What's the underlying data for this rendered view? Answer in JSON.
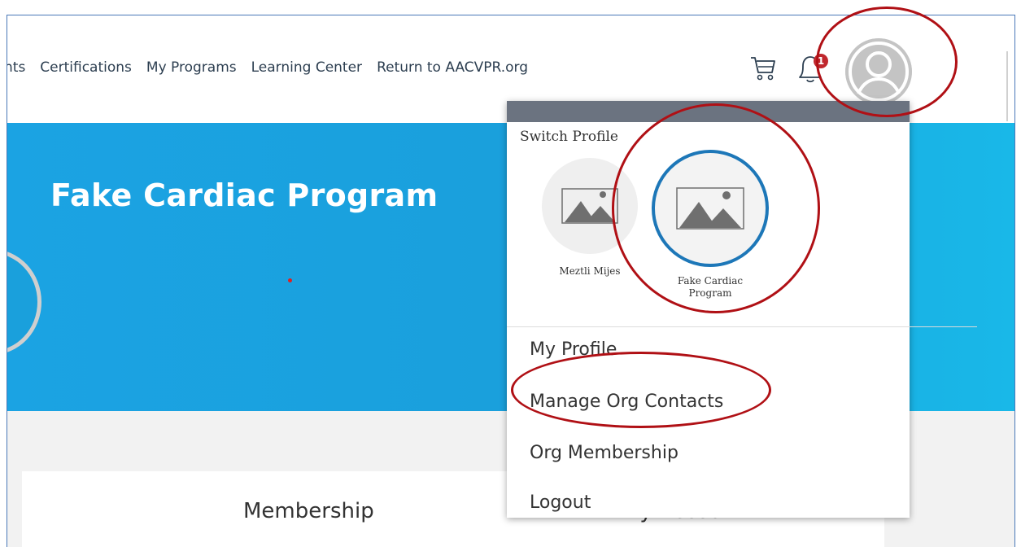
{
  "nav": {
    "links": [
      "nts",
      "Certifications",
      "My Programs",
      "Learning Center",
      "Return to AACVPR.org"
    ],
    "notification_count": "1"
  },
  "hero": {
    "title": "Fake Cardiac Program"
  },
  "dropdown": {
    "switch_profile_label": "Switch Profile",
    "profiles": [
      {
        "name": "Meztli Mijes",
        "active": false
      },
      {
        "name": "Fake Cardiac Program",
        "active": true
      }
    ],
    "menu": [
      "My Profile",
      "Manage Org Contacts",
      "Org Membership",
      "Logout"
    ]
  },
  "lower": {
    "tabs": [
      "Membership",
      "My Account"
    ]
  },
  "colors": {
    "hero_blue": "#1ba3e3",
    "dropdown_header": "#6b7380",
    "active_profile_ring": "#1d77b8",
    "annotation_red": "#b01015",
    "badge_red": "#c0272d"
  },
  "icons": [
    "cart-icon",
    "bell-icon",
    "user-avatar-icon",
    "image-placeholder-icon"
  ]
}
